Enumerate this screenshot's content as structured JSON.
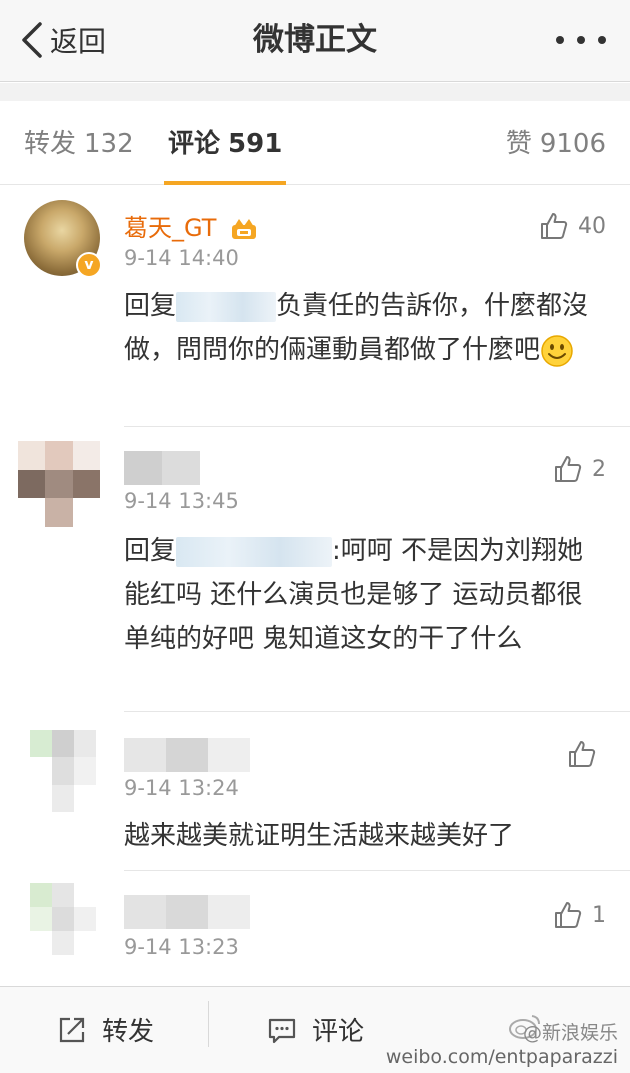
{
  "nav": {
    "back_label": "返回",
    "title": "微博正文"
  },
  "tabs": {
    "repost_label": "转发",
    "repost_count": "132",
    "comments_label": "评论",
    "comments_count": "591",
    "likes_label": "赞",
    "likes_count": "9106"
  },
  "comments": [
    {
      "username": "葛天_GT",
      "time": "9-14 14:40",
      "likes": "40",
      "text_prefix": "回复",
      "text": "负責任的告訴你，什麼都沒做，問問你的倆運動員都做了什麼吧"
    },
    {
      "username": "",
      "time": "9-14 13:45",
      "likes": "2",
      "text_prefix": "回复",
      "text": ":呵呵 不是因为刘翔她能红吗 还什么演员也是够了 运动员都很单纯的好吧 鬼知道这女的干了什么"
    },
    {
      "username": "",
      "time": "9-14 13:24",
      "likes": "",
      "text": "越来越美就证明生活越来越美好了"
    },
    {
      "username": "",
      "time": "9-14 13:23",
      "likes": "1",
      "text": ""
    }
  ],
  "bottom_bar": {
    "repost_label": "转发",
    "comment_label": "评论"
  },
  "watermark": {
    "account": "@新浪娱乐",
    "url": "weibo.com/entpaparazzi"
  },
  "colors": {
    "accent": "#f5a623",
    "username": "#e86b0a",
    "muted": "#999999"
  }
}
